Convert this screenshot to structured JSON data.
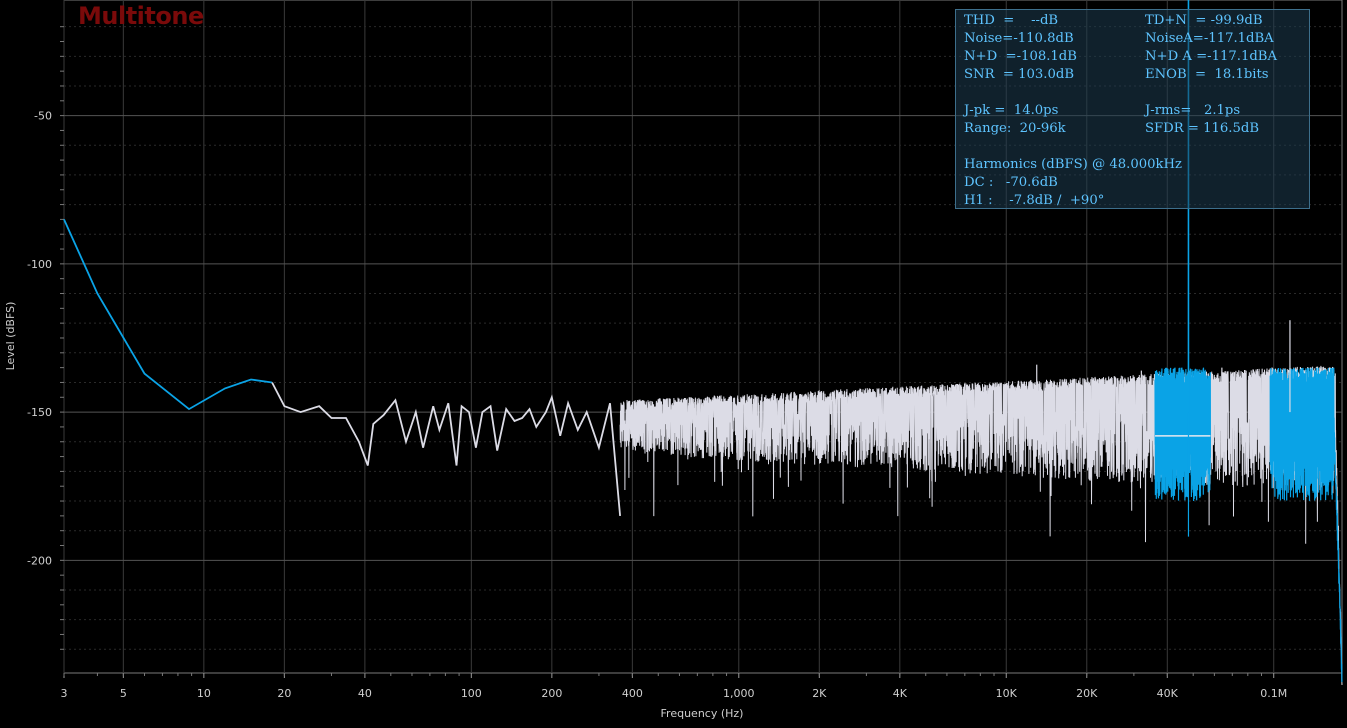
{
  "title": "Multitone",
  "colors": {
    "background": "#000000",
    "grid": "#3a3a3a",
    "title": "#7a0a0a",
    "series_primary": "#0aa3e6",
    "series_secondary": "#dcdce6",
    "panel_text": "#5ec4ff"
  },
  "stats": {
    "rows": [
      [
        "THD  =    --dB",
        "TD+N  = -99.9dB"
      ],
      [
        "Noise=-110.8dB",
        "NoiseA=-117.1dBA"
      ],
      [
        "N+D  =-108.1dB",
        "N+D A =-117.1dBA"
      ],
      [
        "SNR  = 103.0dB",
        "ENOB  =  18.1bits"
      ],
      [
        "",
        ""
      ],
      [
        "J-pk =  14.0ps",
        "J-rms=   2.1ps"
      ],
      [
        "Range:  20-96k",
        "SFDR = 116.5dB"
      ],
      [
        "",
        ""
      ],
      [
        "Harmonics (dBFS) @ 48.000kHz",
        ""
      ],
      [
        "DC :   -70.6dB",
        ""
      ],
      [
        "H1 :    -7.8dB /  +90°",
        ""
      ]
    ]
  },
  "chart_data": {
    "type": "line",
    "title": "Multitone",
    "xlabel": "Frequency (Hz)",
    "ylabel": "Level (dBFS)",
    "xscale": "log",
    "xlim": [
      3,
      180000
    ],
    "ylim": [
      -238,
      -11
    ],
    "x_tick_values": [
      3,
      5,
      10,
      20,
      40,
      100,
      200,
      400,
      1000,
      2000,
      4000,
      10000,
      20000,
      40000,
      100000
    ],
    "x_tick_labels": [
      "3",
      "5",
      "10",
      "20",
      "40",
      "100",
      "200",
      "400",
      "1,000",
      "2K",
      "4K",
      "10K",
      "20K",
      "40K",
      "0.1M"
    ],
    "y_tick_values": [
      -50,
      -100,
      -150,
      -200
    ],
    "y_tick_labels": [
      "-50",
      "-100",
      "-150",
      "-200"
    ],
    "grid": true,
    "series": [
      {
        "color": "#0aa3e6",
        "x": [
          3,
          4,
          6,
          8.8,
          12,
          15,
          18
        ],
        "y": [
          -85,
          -110,
          -137,
          -149,
          -142,
          -139,
          -140
        ]
      },
      {
        "color": "#dcdce6",
        "x": [
          18,
          20,
          23,
          27,
          30,
          34,
          38,
          41,
          43,
          47,
          52,
          57,
          62,
          66,
          72,
          76,
          82,
          88,
          92,
          98,
          104,
          110,
          118,
          125,
          135,
          145,
          155,
          165,
          175,
          190,
          200,
          215,
          230,
          250,
          270,
          300,
          330,
          360
        ],
        "y": [
          -140,
          -148,
          -150,
          -148,
          -152,
          -152,
          -160,
          -168,
          -154,
          -151,
          -146,
          -160,
          -150,
          -162,
          -148,
          -156,
          -147,
          -168,
          -148,
          -150,
          -162,
          -150,
          -148,
          -163,
          -149,
          -153,
          -152,
          -149,
          -155,
          -150,
          -145,
          -158,
          -147,
          -156,
          -150,
          -162,
          -147,
          -185
        ]
      }
    ],
    "noise_floor": {
      "from": 360,
      "to": 180000,
      "mean": -150,
      "color": "#dcdce6"
    },
    "tones": [
      {
        "x": 13000,
        "y": -134
      },
      {
        "x": 32000,
        "y": -136
      },
      {
        "x": 48000,
        "y": -7.8
      },
      {
        "x": 64000,
        "y": -135
      },
      {
        "x": 115000,
        "y": -119
      }
    ]
  }
}
